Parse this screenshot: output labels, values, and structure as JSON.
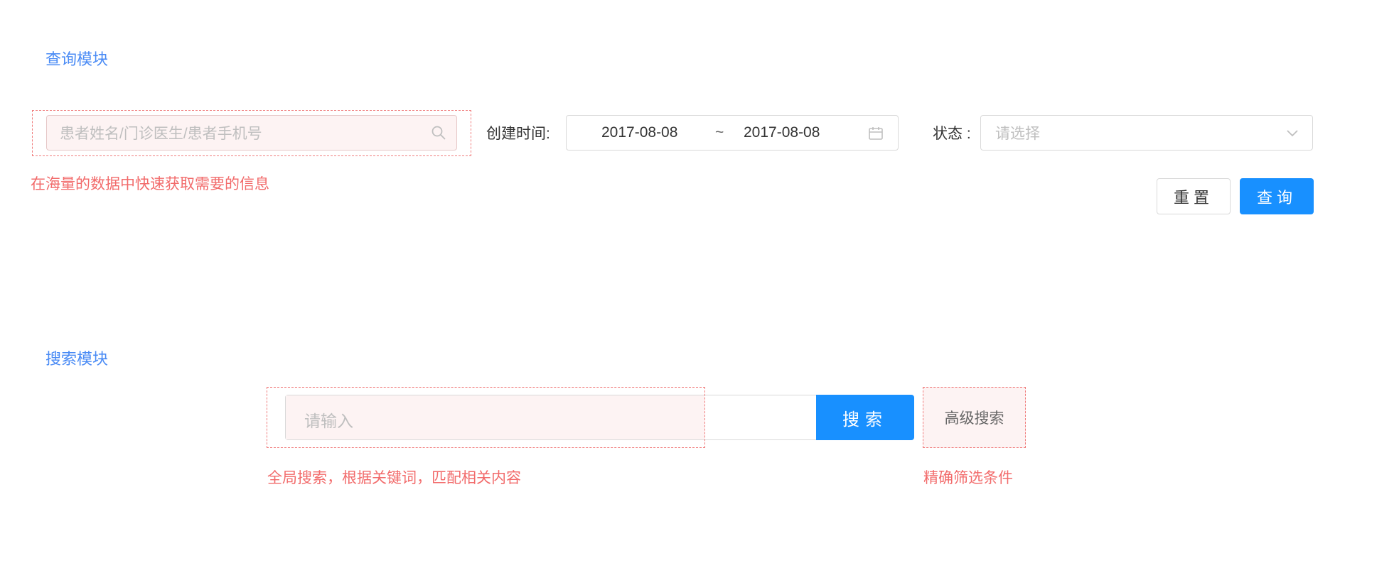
{
  "query_module": {
    "title": "查询模块",
    "search": {
      "placeholder": "患者姓名/门诊医生/患者手机号"
    },
    "annotation": "在海量的数据中快速获取需要的信息",
    "created_time": {
      "label": "创建时间:",
      "start": "2017-08-08",
      "separator": "~",
      "end": "2017-08-08"
    },
    "status": {
      "label": "状态 :",
      "placeholder": "请选择"
    },
    "buttons": {
      "reset": "重置",
      "query": "查询"
    }
  },
  "search_module": {
    "title": "搜索模块",
    "input_placeholder": "请输入",
    "search_button": "搜索",
    "advanced_search": "高级搜索",
    "annotation_global": "全局搜索，根据关键词，匹配相关内容",
    "annotation_advanced": "精确筛选条件"
  },
  "colors": {
    "accent": "#1890ff",
    "title_blue": "#4a8bf5",
    "annotation_red": "#f26b6b",
    "annotation_fill": "#fdf3f3"
  }
}
